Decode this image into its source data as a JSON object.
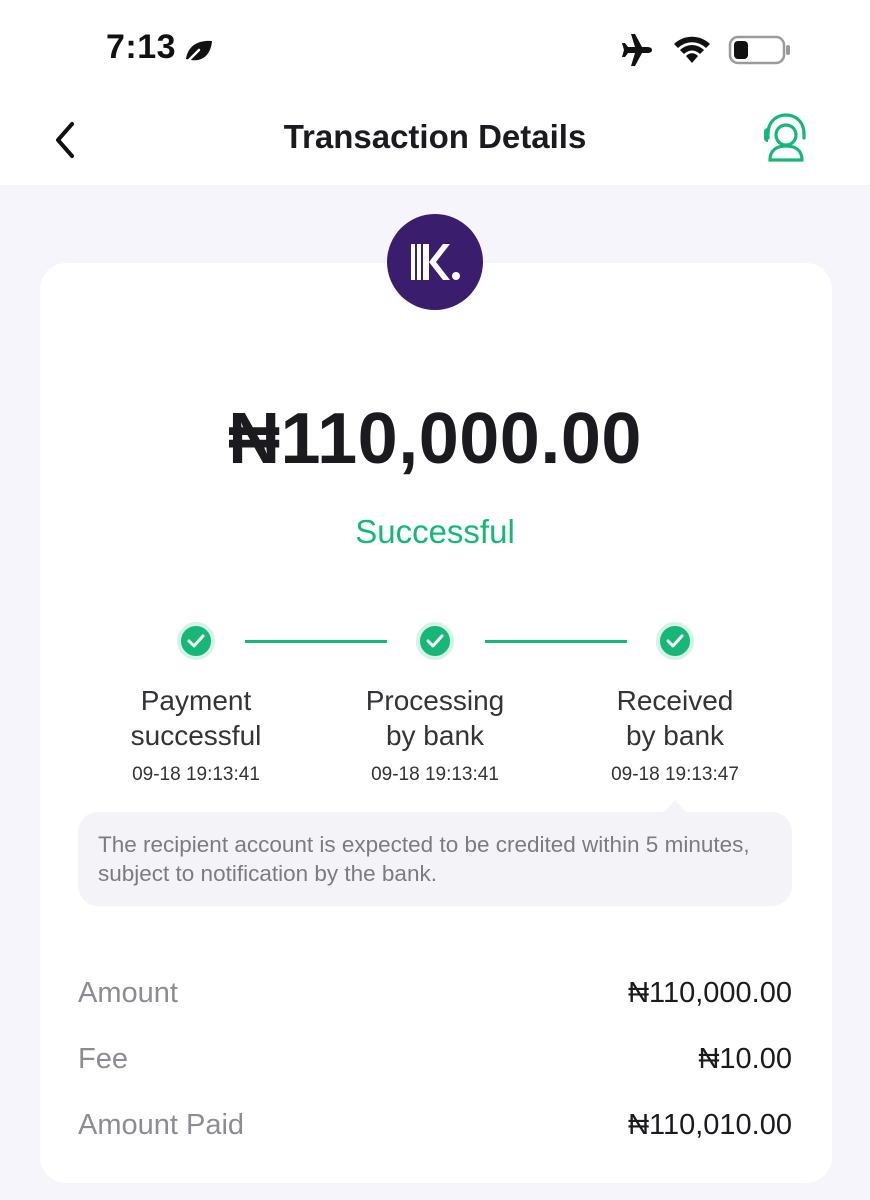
{
  "status_bar": {
    "time": "7:13",
    "icons": [
      "leaf-icon",
      "airplane-icon",
      "wifi-icon",
      "battery-icon"
    ]
  },
  "header": {
    "title": "Transaction Details",
    "back_icon": "chevron-left-icon",
    "support_icon": "customer-support-icon"
  },
  "transaction": {
    "amount": "₦110,000.00",
    "status": "Successful",
    "logo": "K.",
    "steps": [
      {
        "label_line1": "Payment",
        "label_line2": "successful",
        "time": "09-18 19:13:41"
      },
      {
        "label_line1": "Processing",
        "label_line2": "by bank",
        "time": "09-18 19:13:41"
      },
      {
        "label_line1": "Received",
        "label_line2": "by bank",
        "time": "09-18 19:13:47"
      }
    ],
    "note": "The recipient account is expected to be credited within 5 minutes, subject to notification by the bank."
  },
  "summary": [
    {
      "label": "Amount",
      "value": "₦110,000.00"
    },
    {
      "label": "Fee",
      "value": "₦10.00"
    },
    {
      "label": "Amount Paid",
      "value": "₦110,010.00"
    }
  ],
  "colors": {
    "accent_green": "#17b777",
    "logo_purple": "#3b1d6e",
    "background": "#f5f5fb"
  }
}
